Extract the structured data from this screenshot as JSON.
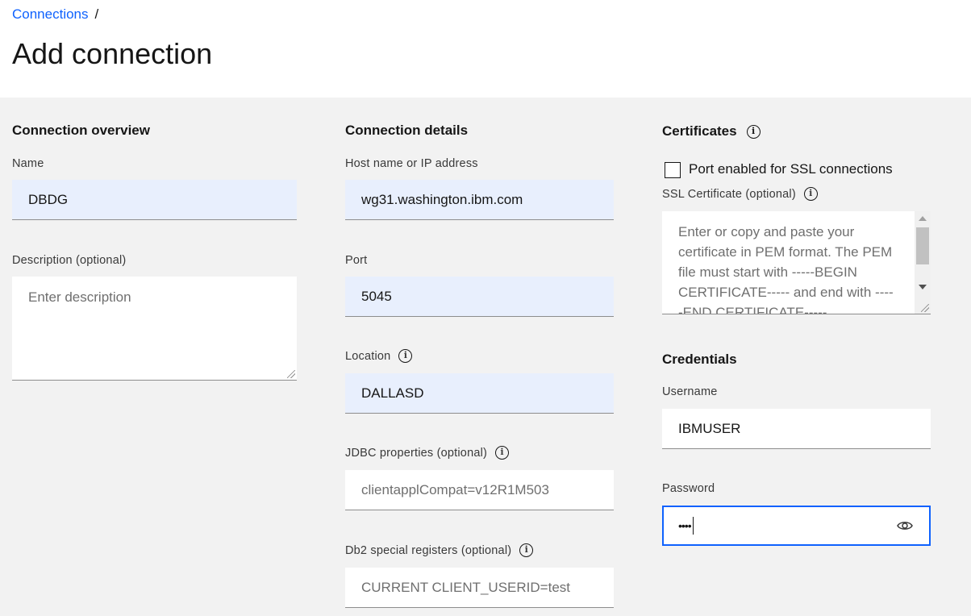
{
  "breadcrumb": {
    "link": "Connections",
    "separator": "/"
  },
  "page": {
    "title": "Add connection"
  },
  "overview": {
    "heading": "Connection overview",
    "name_label": "Name",
    "name_value": "DBDG",
    "description_label": "Description (optional)",
    "description_placeholder": "Enter description"
  },
  "details": {
    "heading": "Connection details",
    "host_label": "Host name or IP address",
    "host_value": "wg31.washington.ibm.com",
    "port_label": "Port",
    "port_value": "5045",
    "location_label": "Location",
    "location_value": "DALLASD",
    "jdbc_label": "JDBC properties (optional)",
    "jdbc_placeholder": "clientapplCompat=v12R1M503",
    "registers_label": "Db2 special registers (optional)",
    "registers_placeholder": "CURRENT CLIENT_USERID=test"
  },
  "certificates": {
    "heading": "Certificates",
    "ssl_checkbox_label": "Port enabled for SSL connections",
    "ssl_checked": false,
    "cert_label": "SSL Certificate (optional)",
    "cert_placeholder": "Enter or copy and paste your certificate in PEM format. The PEM file must start with -----BEGIN CERTIFICATE----- and end with -----END CERTIFICATE-----"
  },
  "credentials": {
    "heading": "Credentials",
    "username_label": "Username",
    "username_value": "IBMUSER",
    "password_label": "Password",
    "password_masked": "••••"
  },
  "icons": {
    "info": "info-icon",
    "eye": "eye-icon"
  },
  "colors": {
    "link": "#0f62fe",
    "filled_field": "#e8effd",
    "focus_border": "#0f62fe",
    "background": "#f2f2f2"
  }
}
